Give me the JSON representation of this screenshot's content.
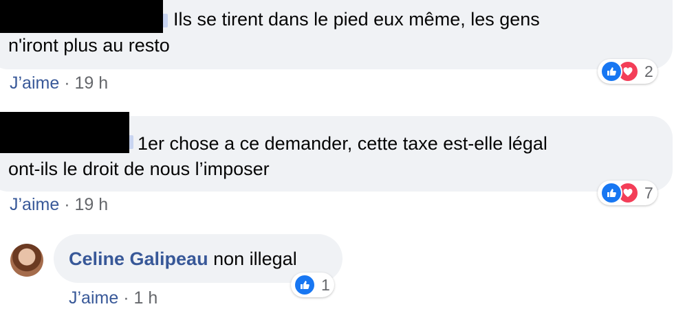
{
  "comments": [
    {
      "text_line1": "Ils se tirent dans le pied eux même, les gens",
      "text_line2": "n'iront plus au resto",
      "like_label": "J’aime",
      "time": "· 19 h",
      "reaction_count": "2"
    },
    {
      "text_line1": "1er chose a ce demander, cette taxe est-elle légal",
      "text_line2": "ont-ils le droit de nous l’imposer",
      "like_label": "J’aime",
      "time": "· 19 h",
      "reaction_count": "7"
    },
    {
      "author": "Celine Galipeau",
      "text": "non illegal",
      "like_label": "J’aime",
      "time": "· 1 h",
      "reaction_count": "1"
    }
  ],
  "colors": {
    "bubble": "#f0f2f5",
    "link": "#385898",
    "meta": "#65676b",
    "like_reaction": "#1877f2",
    "love_reaction": "#f33e58"
  },
  "icons": [
    "thumbs-up-reaction-icon",
    "heart-reaction-icon",
    "avatar"
  ]
}
